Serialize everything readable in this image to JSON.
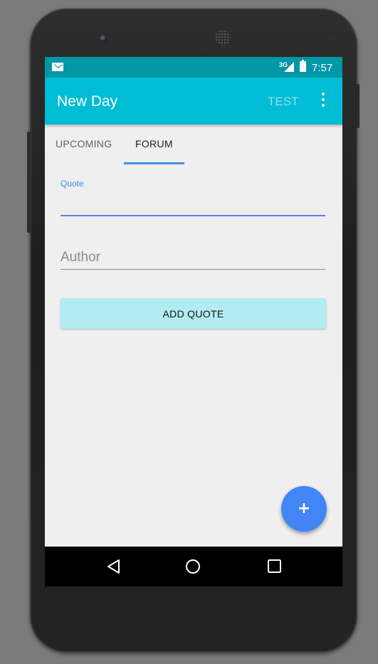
{
  "status_bar": {
    "network": "3G",
    "time": "7:57"
  },
  "app_bar": {
    "title": "New Day",
    "action_label": "TEST"
  },
  "tabs": [
    {
      "label": "UPCOMING",
      "selected": false
    },
    {
      "label": "FORUM",
      "selected": true
    }
  ],
  "form": {
    "quote_label": "Quote",
    "quote_value": "",
    "author_placeholder": "Author",
    "author_value": "",
    "submit_label": "ADD QUOTE"
  },
  "fab": {
    "label": "+"
  },
  "icons": {
    "notification": "mail-icon",
    "signal": "signal-icon",
    "battery": "battery-icon",
    "overflow": "more-vert-icon",
    "back": "back-icon",
    "home": "home-icon",
    "recent": "recent-apps-icon"
  },
  "colors": {
    "status_bar": "#0097a7",
    "app_bar": "#00bcd4",
    "accent": "#4285f4",
    "button_bg": "#b2ebf2"
  }
}
